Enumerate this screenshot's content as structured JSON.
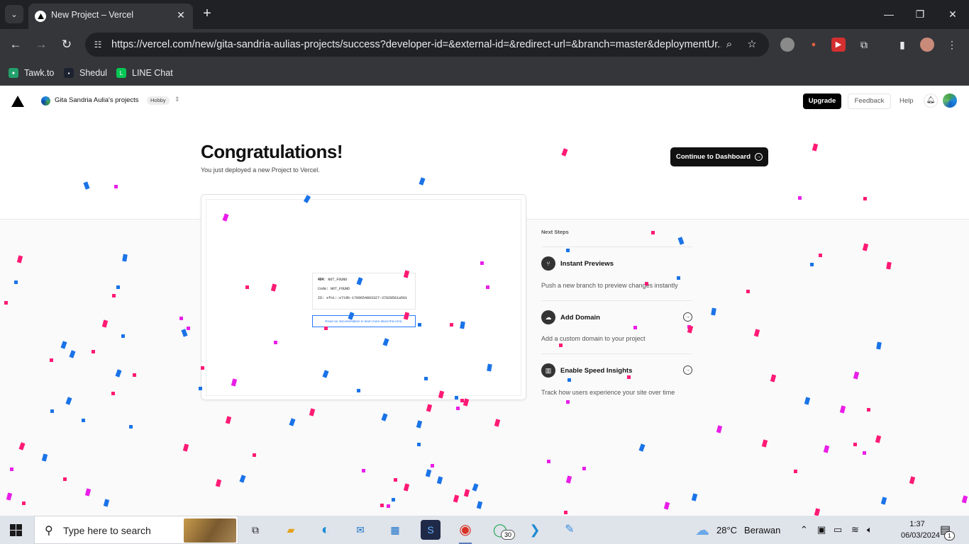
{
  "browser": {
    "tab_title": "New Project – Vercel",
    "url": "https://vercel.com/new/gita-sandria-aulias-projects/success?developer-id=&external-id=&redirect-url=&branch=master&deploymentUr...",
    "bookmarks": [
      {
        "label": "Tawk.to",
        "icon": "tawk-icon",
        "color": "#22a06b"
      },
      {
        "label": "Shedul",
        "icon": "shedul-icon",
        "color": "#1c2230"
      },
      {
        "label": "LINE Chat",
        "icon": "line-icon",
        "color": "#06c755"
      }
    ],
    "extension_colors": [
      "#8a8a8a",
      "#e8603c",
      "#d32f2f",
      "#e8eaed"
    ]
  },
  "header": {
    "team_name": "Gita Sandria Aulia's projects",
    "plan_badge": "Hobby",
    "upgrade_label": "Upgrade",
    "feedback_label": "Feedback",
    "help_label": "Help"
  },
  "main": {
    "title": "Congratulations!",
    "subtitle": "You just deployed a new Project to Vercel.",
    "continue_label": "Continue to Dashboard",
    "preview": {
      "error_code": "404",
      "error_status": "NOT_FOUND",
      "code_label": "Code:",
      "code_value": "NOT_FOUND",
      "id_label": "ID:",
      "id_value": "sfo1::s7t9b-1709654803327-37928561a501",
      "doc_link": "Read our documentation to learn more about this error."
    }
  },
  "next_steps": {
    "title": "Next Steps",
    "items": [
      {
        "title": "Instant Previews",
        "desc": "Push a new branch to preview changes instantly",
        "icon": "branch-icon"
      },
      {
        "title": "Add Domain",
        "desc": "Add a custom domain to your project",
        "icon": "cloud-icon"
      },
      {
        "title": "Enable Speed Insights",
        "desc": "Track how users experience your site over time",
        "icon": "bar-chart-icon"
      }
    ]
  },
  "colors": {
    "confetti_pink": "#ff1a75",
    "confetti_magenta": "#e91ee8",
    "confetti_blue": "#1a73e8",
    "accent": "#000000"
  },
  "taskbar": {
    "search_placeholder": "Type here to search",
    "weather_temp": "28°C",
    "weather_desc": "Berawan",
    "time": "1:37",
    "date": "06/03/2024",
    "whatsapp_badge": "30",
    "notification_count": "1"
  }
}
